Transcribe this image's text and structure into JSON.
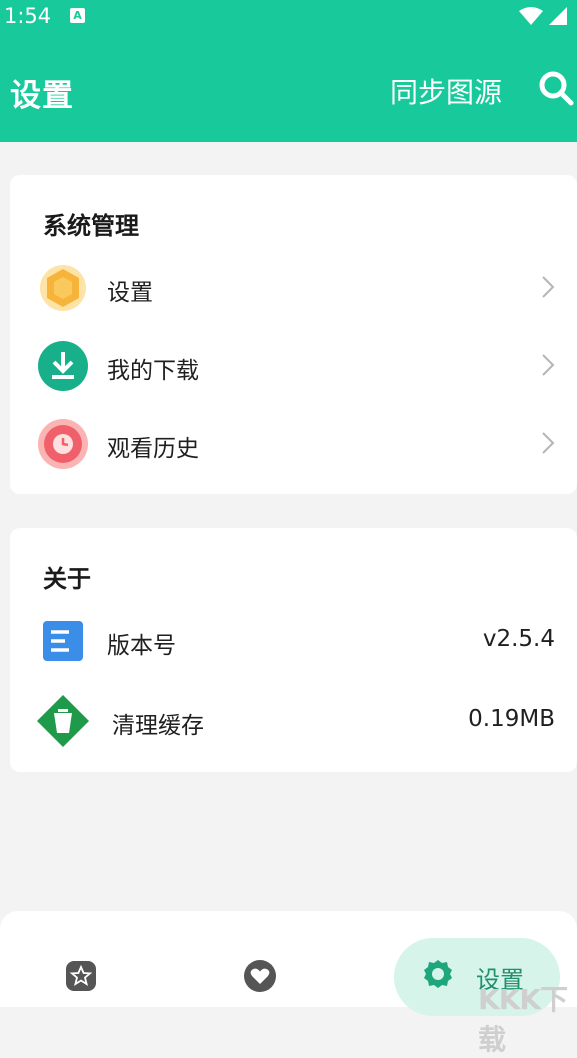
{
  "status_bar": {
    "time": "1:54",
    "notification_icon": "A",
    "icons": [
      "wifi-icon",
      "signal-icon"
    ]
  },
  "header": {
    "title": "设置",
    "sync_label": "同步图源",
    "search_icon": "search-icon"
  },
  "system_section": {
    "title": "系统管理",
    "items": [
      {
        "label": "设置",
        "icon": "hexagon-icon",
        "color": "#f6b53a"
      },
      {
        "label": "我的下载",
        "icon": "download-icon",
        "color": "#18b08a"
      },
      {
        "label": "观看历史",
        "icon": "clock-icon",
        "color": "#f0606a"
      }
    ]
  },
  "about_section": {
    "title": "关于",
    "items": [
      {
        "label": "版本号",
        "value": "v2.5.4",
        "icon": "document-icon",
        "color": "#3b8ee8"
      },
      {
        "label": "清理缓存",
        "value": "0.19MB",
        "icon": "trash-cup-icon",
        "color": "#1e9a4a"
      }
    ]
  },
  "bottom_nav": {
    "items": [
      {
        "icon": "star-icon"
      },
      {
        "icon": "heart-icon"
      },
      {
        "icon": "gear-icon",
        "label": "设置",
        "active": true
      }
    ]
  },
  "watermark": "KKK下载",
  "colors": {
    "primary": "#18c99b",
    "background": "#f3f3f3",
    "active_pill": "#d6f4ea"
  }
}
